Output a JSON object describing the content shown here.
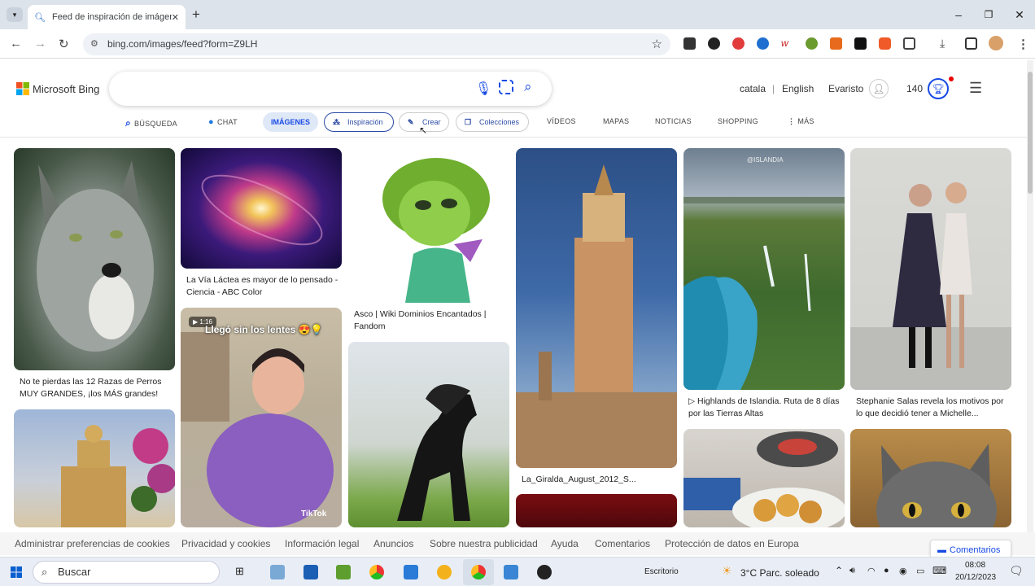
{
  "browser": {
    "tab_title": "Feed de inspiración de imágene",
    "url": "bing.com/images/feed?form=Z9LH",
    "new_tab": "+",
    "minimize": "–",
    "restore": "❐",
    "close": "✕"
  },
  "bing": {
    "logo_text": "Microsoft Bing",
    "search_placeholder": "",
    "lang1": "catala",
    "sep": "|",
    "lang2": "English",
    "user": "Evaristo",
    "points": "140"
  },
  "nav": {
    "busqueda": "BÚSQUEDA",
    "chat": "CHAT",
    "imagenes": "IMÁGENES",
    "inspiracion": "Inspiración",
    "crear": "Crear",
    "colecciones": "Colecciones",
    "videos": "VÍDEOS",
    "mapas": "MAPAS",
    "noticias": "NOTICIAS",
    "shopping": "SHOPPING",
    "mas": "MÁS"
  },
  "cards": {
    "wolf": "No te pierdas las 12 Razas de Perros MUY GRANDES, ¡los MÁS grandes!",
    "galaxy": "La Vía Láctea es mayor de lo pensado - Ciencia - ABC Color",
    "asco": "Asco | Wiki Dominios Encantados | Fandom",
    "giralda": "La_Giralda_August_2012_S...",
    "iceland": "▷ Highlands de Islandia. Ruta de 8 días por las Tierras Altas",
    "stephanie": "Stephanie Salas revela los motivos por lo que decidió tener a Michelle...",
    "video_duration": "1:16",
    "video_overlay": "Llegó sin los lentes 😍💡",
    "tiktok": "TikTok",
    "watermark": "@ISLANDIA"
  },
  "cookies": {
    "items": [
      "Administrar preferencias de cookies",
      "Privacidad y cookies",
      "Información legal",
      "Anuncios",
      "Sobre nuestra publicidad",
      "Ayuda",
      "Comentarios",
      "Protección de datos en Europa"
    ],
    "feedback_button": "Comentarios"
  },
  "taskbar": {
    "search": "Buscar",
    "desktop": "Escritorio",
    "weather": "3°C  Parc. soleado",
    "time": "08:08",
    "date": "20/12/2023"
  }
}
